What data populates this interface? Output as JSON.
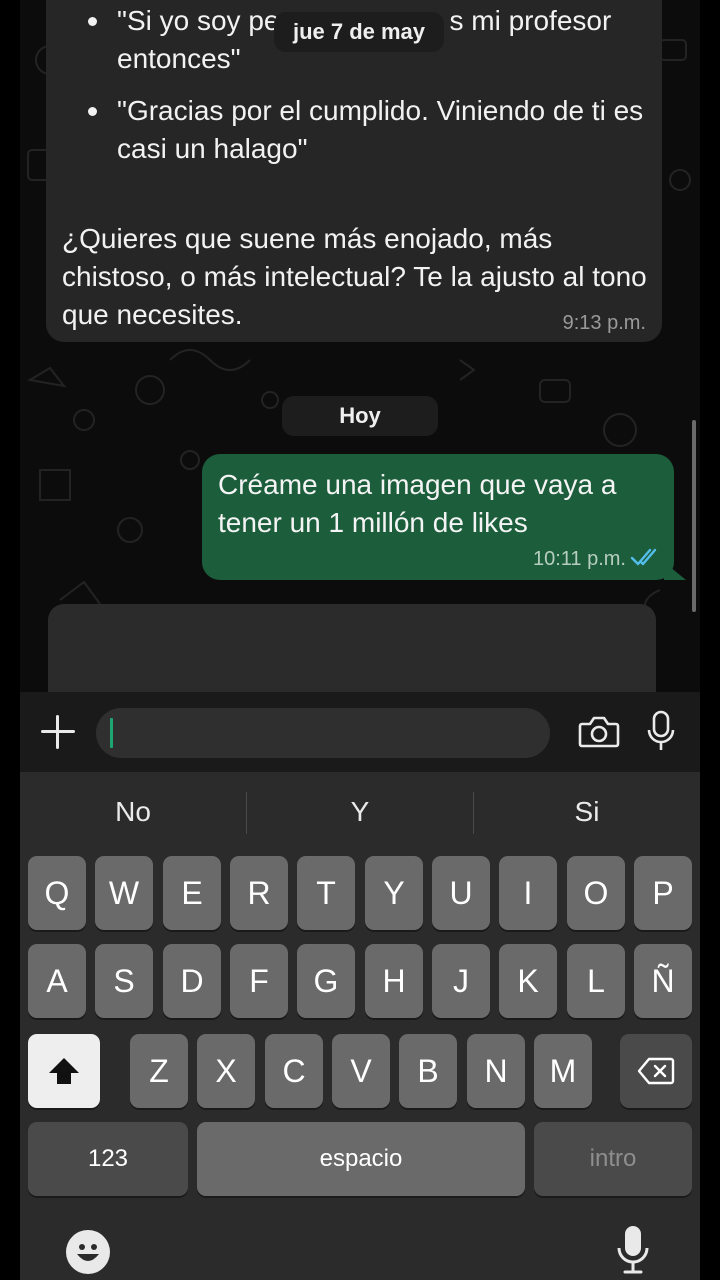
{
  "chat": {
    "bubble_in": {
      "bullet_1": "\"Si yo soy pe",
      "bullet_1_tail": "s mi profesor entonces\"",
      "bullet_2": "\"Gracias por el cumplido. Viniendo de ti es casi un halago\"",
      "paragraph": "¿Quieres que suene más enojado, más chistoso, o más intelectual? Te la ajusto al tono que necesites.",
      "time": "9:13 p.m."
    },
    "floating_date": "jue 7 de may",
    "date_separator": "Hoy",
    "bubble_out": {
      "text": "Créame una imagen que vaya a tener un 1 millón de likes",
      "time": "10:11 p.m.",
      "ticks_color": "#53bdeb"
    }
  },
  "input_bar": {
    "plus_icon": "plus-icon",
    "camera_icon": "camera-icon",
    "mic_icon": "microphone-icon",
    "caret_color": "#1ea672"
  },
  "keyboard": {
    "suggestions": [
      "No",
      "Y",
      "Si"
    ],
    "row1": [
      "Q",
      "W",
      "E",
      "R",
      "T",
      "Y",
      "U",
      "I",
      "O",
      "P"
    ],
    "row2": [
      "A",
      "S",
      "D",
      "F",
      "G",
      "H",
      "J",
      "K",
      "L",
      "Ñ"
    ],
    "row3": [
      "Z",
      "X",
      "C",
      "V",
      "B",
      "N",
      "M"
    ],
    "numbers_label": "123",
    "space_label": "espacio",
    "return_label": "intro",
    "shift_icon": "shift-icon",
    "delete_icon": "backspace-icon",
    "emoji_icon": "emoji-icon",
    "dictation_icon": "microphone-icon"
  }
}
